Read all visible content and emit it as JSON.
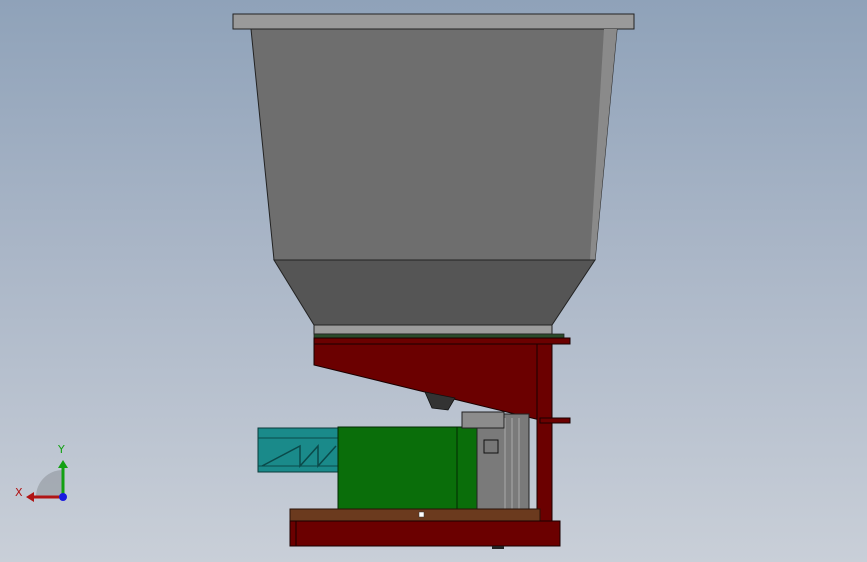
{
  "viewport": {
    "background_top": "#8fa2b9",
    "background_bottom": "#c9cfd8"
  },
  "model": {
    "hopper_color": "#6e6e6e",
    "hopper_lower_color": "#555555",
    "frame_color": "#6b0000",
    "motor_color": "#0a6e0a",
    "gearbox_color": "#7a7a7a",
    "conveyor_color": "#1a8a8a",
    "base_plate_color": "#6b3a1e"
  },
  "triad": {
    "x_label": "X",
    "y_label": "Y",
    "x_color": "#b01414",
    "y_color": "#12a012",
    "z_color": "#1a1adf"
  }
}
